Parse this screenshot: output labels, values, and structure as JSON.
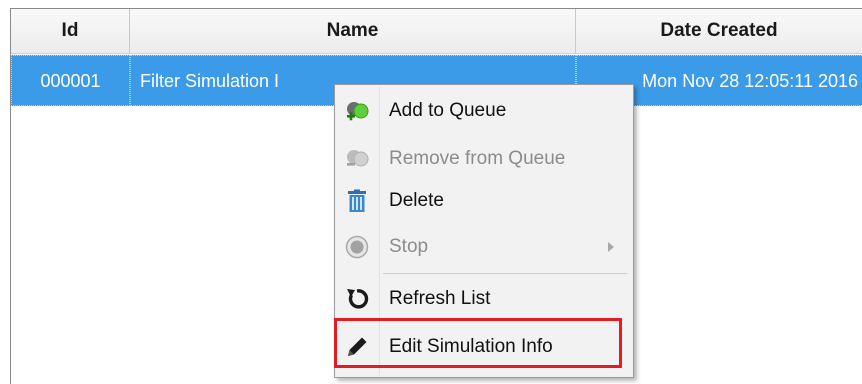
{
  "table": {
    "columns": [
      "Id",
      "Name",
      "Date Created"
    ],
    "rows": [
      {
        "id": "000001",
        "name": "Filter Simulation I",
        "date_created": "Mon Nov 28 12:05:11 2016"
      }
    ]
  },
  "context_menu": {
    "items": [
      {
        "label": "Add to Queue",
        "icon": "add-queue-icon",
        "enabled": true
      },
      {
        "label": "Remove from Queue",
        "icon": "remove-queue-icon",
        "enabled": false
      },
      {
        "label": "Delete",
        "icon": "trash-icon",
        "enabled": true
      },
      {
        "label": "Stop",
        "icon": "stop-icon",
        "enabled": false,
        "has_submenu": true
      },
      {
        "label": "Refresh List",
        "icon": "refresh-icon",
        "enabled": true
      },
      {
        "label": "Edit Simulation Info",
        "icon": "pencil-icon",
        "enabled": true,
        "highlighted": true
      }
    ]
  },
  "colors": {
    "selection": "#3c9be8",
    "highlight_box": "#e21b24",
    "menu_bg": "#f2f2f2"
  }
}
